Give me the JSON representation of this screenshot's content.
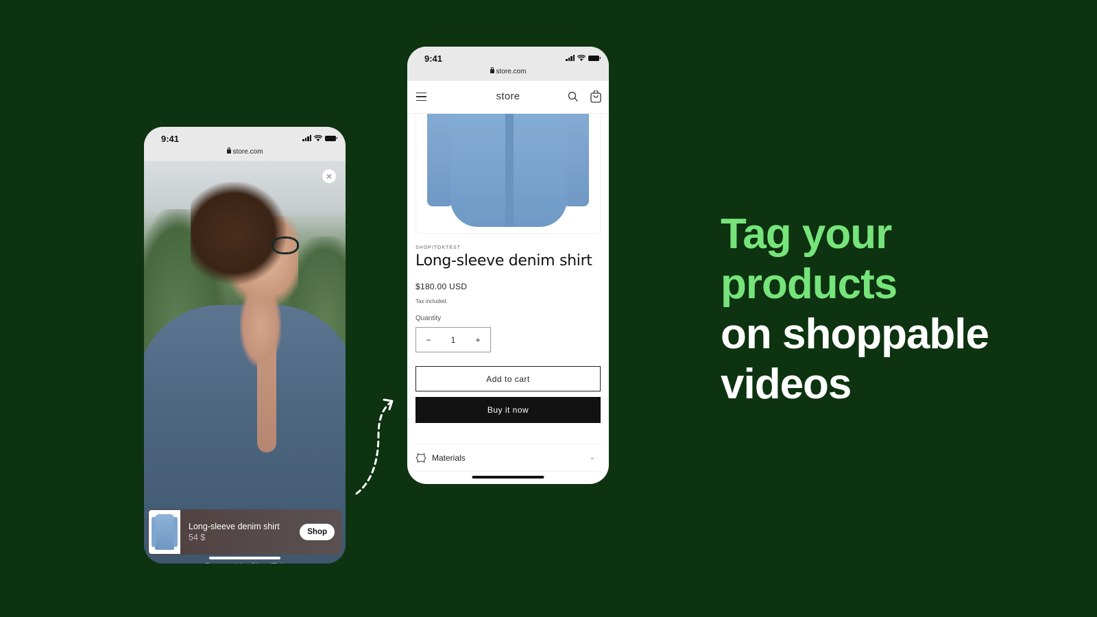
{
  "colors": {
    "background": "#0d3310",
    "headline_accent": "#76e47b",
    "headline_text": "#ffffff",
    "buy_button": "#121212"
  },
  "left_phone": {
    "status_time": "9:41",
    "url": "store.com",
    "icons": [
      "signal-icon",
      "wifi-icon",
      "battery-icon",
      "lock-icon",
      "close-icon"
    ],
    "close_label": "×",
    "product_card": {
      "title": "Long-sleeve denim shirt",
      "price": "54 $",
      "shop_label": "Shop"
    },
    "powered_by": "Powered by ShopiTok"
  },
  "right_phone": {
    "status_time": "9:41",
    "url": "store.com",
    "store_name": "store",
    "icons": [
      "menu-icon",
      "search-icon",
      "cart-icon",
      "materials-icon",
      "chevron-down-icon"
    ],
    "product": {
      "vendor": "SHOPITOKTEST",
      "title": "Long-sleeve denim shirt",
      "price": "$180.00 USD",
      "tax_note": "Tax included.",
      "quantity_label": "Quantity",
      "quantity_value": "1",
      "decrement": "−",
      "increment": "+",
      "add_to_cart": "Add to cart",
      "buy_now": "Buy it now",
      "accordion_label": "Materials",
      "accordion_chevron": "⌄"
    }
  },
  "headline": {
    "line1": "Tag your",
    "line2": "products",
    "line3": "on shoppable",
    "line4": "videos"
  }
}
